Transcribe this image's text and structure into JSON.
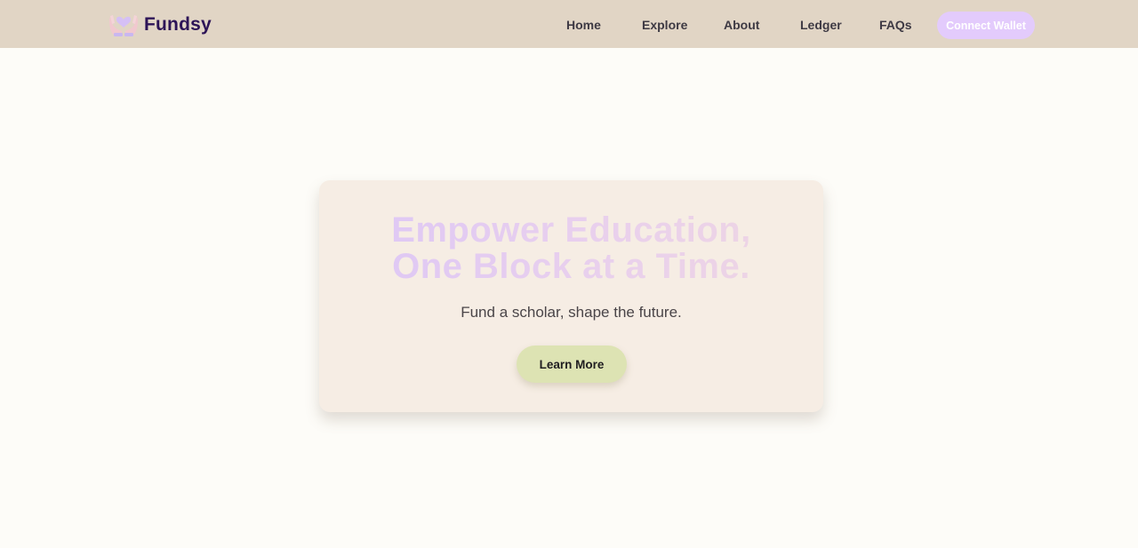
{
  "brand": {
    "name": "Fundsy",
    "icon": "heart-hands-icon"
  },
  "nav": {
    "items": [
      {
        "label": "Home"
      },
      {
        "label": "Explore"
      },
      {
        "label": "About"
      },
      {
        "label": "Ledger"
      },
      {
        "label": "FAQs"
      }
    ],
    "connect_label": "Connect Wallet"
  },
  "hero": {
    "title_line1": "Empower Education,",
    "title_line2": "One Block at a Time.",
    "subtitle": "Fund a scholar, shape the future.",
    "cta_label": "Learn More"
  },
  "colors": {
    "navbar_bg": "#e1d5c5",
    "page_bg": "#fdfcf8",
    "brand_text": "#2d1457",
    "connect_button": "#e3cbfc",
    "card_bg": "#f6ede4",
    "cta_button": "#dde3b3",
    "title_gradient_start": "#dcc6f6",
    "title_gradient_end": "#efd6e2"
  }
}
